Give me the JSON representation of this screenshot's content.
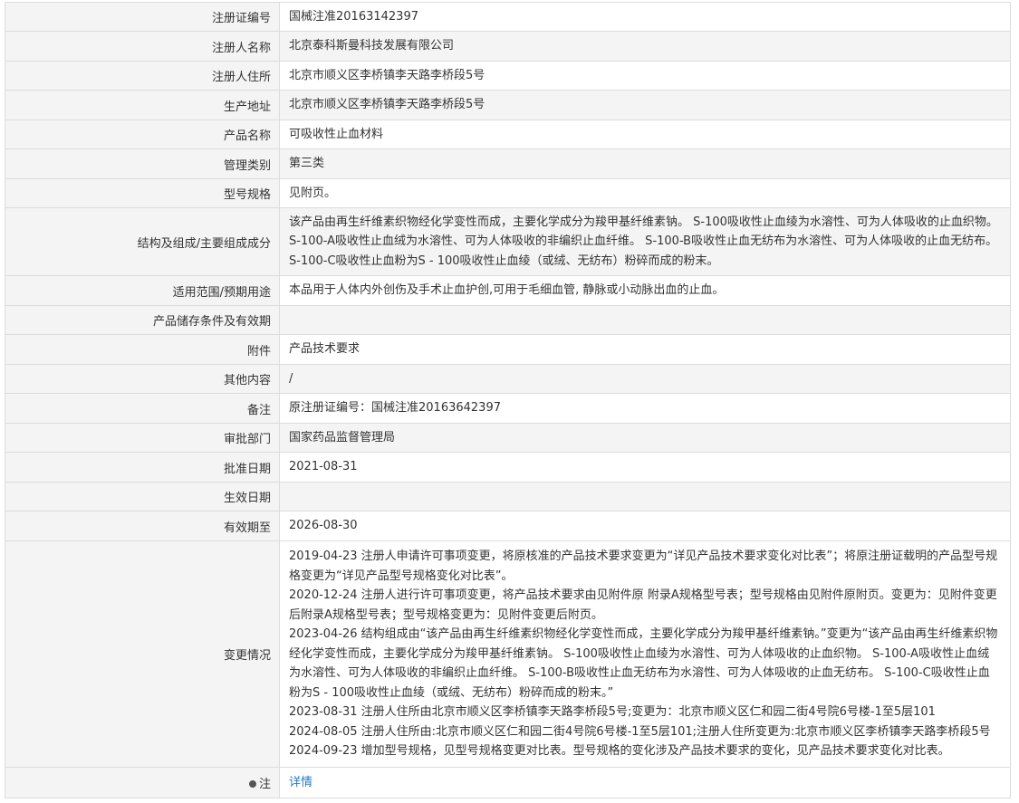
{
  "rows": [
    {
      "label": "注册证编号",
      "value": "国械注准20163142397"
    },
    {
      "label": "注册人名称",
      "value": "北京泰科斯曼科技发展有限公司"
    },
    {
      "label": "注册人住所",
      "value": "北京市顺义区李桥镇李天路李桥段5号"
    },
    {
      "label": "生产地址",
      "value": "北京市顺义区李桥镇李天路李桥段5号"
    },
    {
      "label": "产品名称",
      "value": "可吸收性止血材料"
    },
    {
      "label": "管理类别",
      "value": "第三类"
    },
    {
      "label": "型号规格",
      "value": "见附页。"
    },
    {
      "label": "结构及组成/主要组成成分",
      "value": "该产品由再生纤维素织物经化学变性而成，主要化学成分为羧甲基纤维素钠。 S-100吸收性止血绫为水溶性、可为人体吸收的止血织物。 S-100-A吸收性止血绒为水溶性、可为人体吸收的非编织止血纤维。 S-100-B吸收性止血无纺布为水溶性、可为人体吸收的止血无纺布。 S-100-C吸收性止血粉为S - 100吸收性止血绫（或绒、无纺布）粉碎而成的粉末。"
    },
    {
      "label": "适用范围/预期用途",
      "value": "本品用于人体内外创伤及手术止血护创,可用于毛细血管, 静脉或小动脉出血的止血。"
    },
    {
      "label": "产品储存条件及有效期",
      "value": ""
    },
    {
      "label": "附件",
      "value": "产品技术要求"
    },
    {
      "label": "其他内容",
      "value": "/"
    },
    {
      "label": "备注",
      "value": "原注册证编号：国械注准20163642397"
    },
    {
      "label": "审批部门",
      "value": "国家药品监督管理局"
    },
    {
      "label": "批准日期",
      "value": "2021-08-31"
    },
    {
      "label": "生效日期",
      "value": ""
    },
    {
      "label": "有效期至",
      "value": "2026-08-30"
    }
  ],
  "changes": {
    "label": "变更情况",
    "entries": [
      "2019-04-23 注册人申请许可事项变更，将原核准的产品技术要求变更为“详见产品技术要求变化对比表”；将原注册证载明的产品型号规格变更为“详见产品型号规格变化对比表”。",
      "2020-12-24 注册人进行许可事项变更，将产品技术要求由见附件原 附录A规格型号表；型号规格由见附件原附页。变更为：见附件变更后附录A规格型号表；型号规格变更为：见附件变更后附页。",
      "2023-04-26 结构组成由“该产品由再生纤维素织物经化学变性而成，主要化学成分为羧甲基纤维素钠。”变更为“该产品由再生纤维素织物经化学变性而成，主要化学成分为羧甲基纤维素钠。 S-100吸收性止血绫为水溶性、可为人体吸收的止血织物。 S-100-A吸收性止血绒为水溶性、可为人体吸收的非编织止血纤维。 S-100-B吸收性止血无纺布为水溶性、可为人体吸收的止血无纺布。 S-100-C吸收性止血粉为S - 100吸收性止血绫（或绒、无纺布）粉碎而成的粉末。”",
      "2023-08-31 注册人住所由北京市顺义区李桥镇李天路李桥段5号;变更为：北京市顺义区仁和园二街4号院6号楼-1至5层101",
      "2024-08-05 注册人住所由:北京市顺义区仁和园二街4号院6号楼-1至5层101;注册人住所变更为:北京市顺义区李桥镇李天路李桥段5号",
      "2024-09-23 增加型号规格，见型号规格变更对比表。型号规格的变化涉及产品技术要求的变化，见产品技术要求变化对比表。"
    ]
  },
  "note": {
    "label": "注",
    "link_text": "详情"
  }
}
